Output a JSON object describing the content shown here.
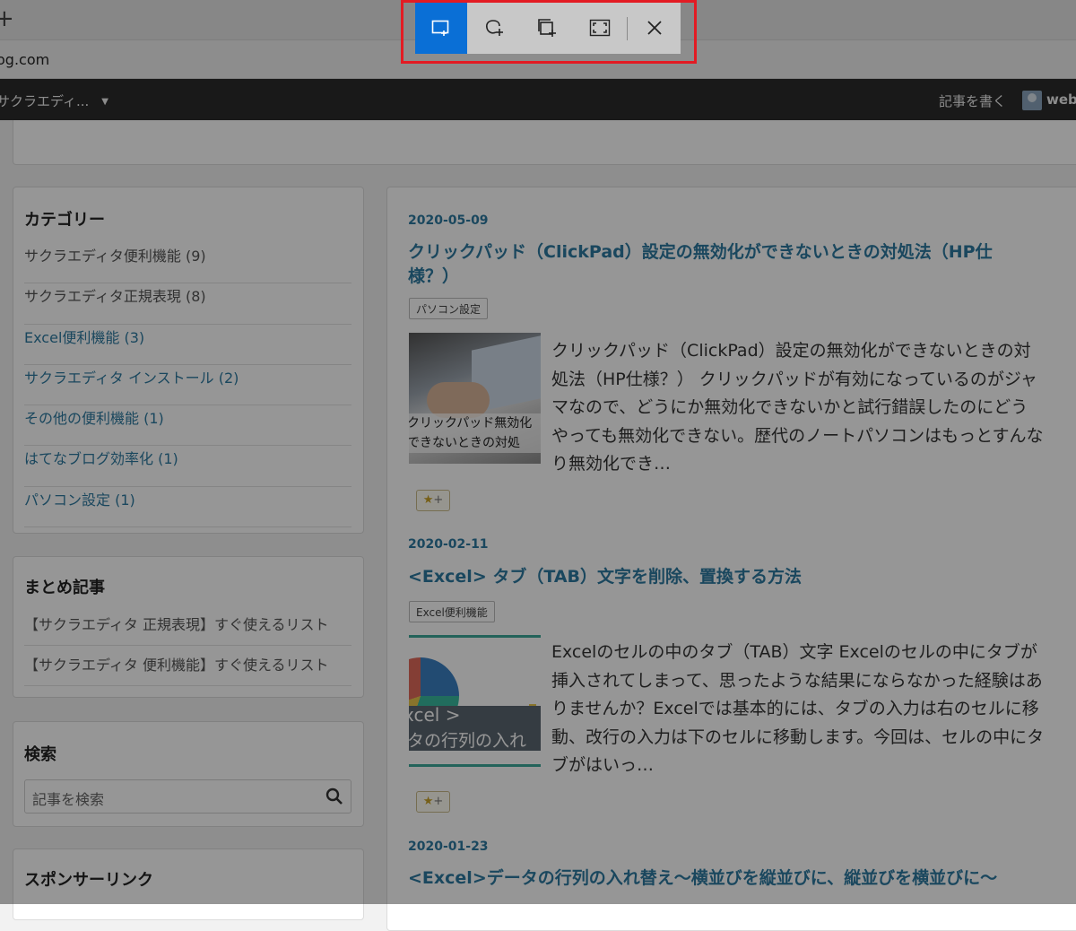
{
  "browser": {
    "new_tab": "+",
    "address": "og.com"
  },
  "admin_bar": {
    "blog_name": "サクラエディ...",
    "caret": "▼",
    "write_post": "記事を書く",
    "user": "webz"
  },
  "sidebar": {
    "categories": {
      "title": "カテゴリー",
      "items": [
        {
          "label": "サクラエディタ便利機能 (9)"
        },
        {
          "label": "サクラエディタ正規表現 (8)"
        },
        {
          "label": "Excel便利機能 (3)"
        },
        {
          "label": "サクラエディタ インストール (2)"
        },
        {
          "label": "その他の便利機能 (1)"
        },
        {
          "label": "はてなブログ効率化 (1)"
        },
        {
          "label": "パソコン設定 (1)"
        }
      ]
    },
    "matome": {
      "title": "まとめ記事",
      "items": [
        {
          "label": "【サクラエディタ 正規表現】すぐ使えるリスト"
        },
        {
          "label": "【サクラエディタ 便利機能】すぐ使えるリスト"
        }
      ]
    },
    "search": {
      "title": "検索",
      "placeholder": "記事を検索"
    },
    "sponsor": {
      "title": "スポンサーリンク"
    }
  },
  "posts": [
    {
      "date": "2020-05-09",
      "title": "クリックパッド（ClickPad）設定の無効化ができないときの対処法（HP仕様？）",
      "category": "パソコン設定",
      "thumb_caption_1": "クリックパッド無効化",
      "thumb_caption_2": "できないときの対処",
      "excerpt": "クリックパッド（ClickPad）設定の無効化ができないときの対処法（HP仕様？） クリックパッドが有効になっているのがジャマなので、どうにか無効化できないかと試行錯誤したのにどうやっても無効化できない。歴代のノートパソコンはもっとすんなり無効化でき…",
      "star": "★",
      "star_plus": "+"
    },
    {
      "date": "2020-02-11",
      "title": "<Excel> タブ（TAB）文字を削除、置換する方法",
      "category": "Excel便利機能",
      "thumb_caption_1": "xcel >",
      "thumb_caption_2": "タの行列の入れ",
      "excerpt": "Excelのセルの中のタブ（TAB）文字 Excelのセルの中にタブが挿入されてしまって、思ったような結果にならなかった経験はありませんか？Excelでは基本的には、タブの入力は右のセルに移動、改行の入力は下のセルに移動します。今回は、セルの中にタブがはいっ…",
      "star": "★",
      "star_plus": "+"
    },
    {
      "date": "2020-01-23",
      "title": "<Excel>データの行列の入れ替え～横並びを縦並びに、縦並びを横並びに～"
    }
  ],
  "snip_toolbar": {
    "modes": [
      "rectangular-snip",
      "freeform-snip",
      "window-snip",
      "fullscreen-snip"
    ],
    "active_mode": "rectangular-snip",
    "accent": "#0a6fd6",
    "highlight_outline": "#e31b23"
  }
}
